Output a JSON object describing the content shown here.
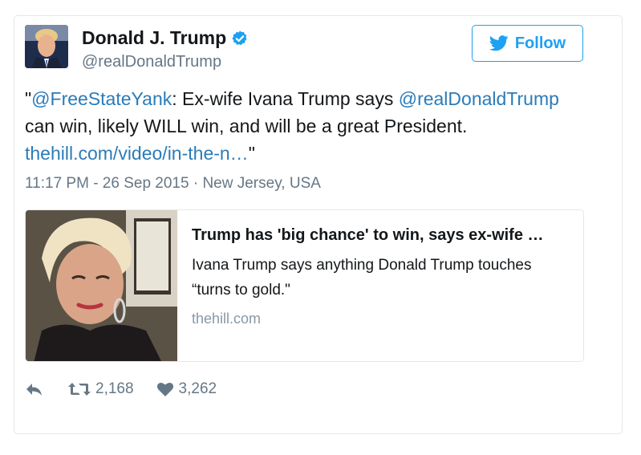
{
  "tweet": {
    "author_name": "Donald J. Trump",
    "author_handle": "@realDonaldTrump",
    "follow_label": "Follow",
    "text_quote_open": "\"",
    "mention_1": "@FreeStateYank",
    "text_part_1": ": Ex-wife Ivana Trump says ",
    "mention_2": "@realDonaldTrump",
    "text_part_2": " can win, likely WILL win, and will be a great President. ",
    "link": "thehill.com/video/in-the-n…",
    "text_quote_close": "\"",
    "timestamp": "11:17 PM - 26 Sep 2015 · New Jersey, USA"
  },
  "card": {
    "title": "Trump has 'big chance' to win, says ex-wife …",
    "description": "Ivana Trump says anything Donald Trump touches “turns to gold.\"",
    "domain": "thehill.com"
  },
  "actions": {
    "retweets": "2,168",
    "likes": "3,262"
  },
  "colors": {
    "accent": "#1da1f2",
    "link": "#2b7bb9",
    "muted": "#657786"
  }
}
